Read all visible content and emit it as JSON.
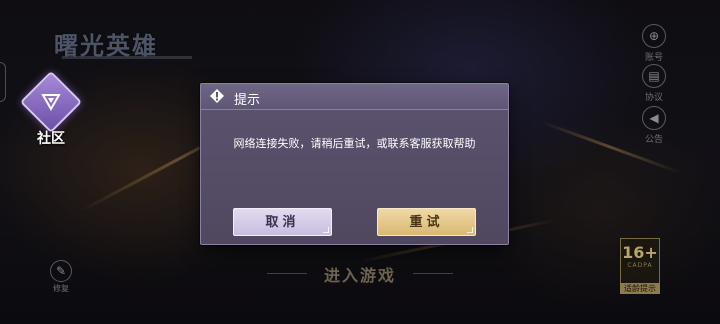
{
  "game": {
    "logo_text": "曙光英雄",
    "community_label": "社区",
    "enter_game_label": "进入游戏"
  },
  "side_buttons": [
    {
      "icon": "account-icon",
      "glyph": "⊕",
      "label": "账号"
    },
    {
      "icon": "document-icon",
      "glyph": "▤",
      "label": "协议"
    },
    {
      "icon": "megaphone-icon",
      "glyph": "◀",
      "label": "公告"
    }
  ],
  "repair": {
    "icon": "wrench-icon",
    "glyph": "✎",
    "label": "修复"
  },
  "age_rating": {
    "number": "16+",
    "org": "CADPA",
    "label": "适龄提示"
  },
  "dialog": {
    "title": "提示",
    "message": "网络连接失败，请稍后重试，或联系客服获取帮助",
    "cancel_label": "取消",
    "retry_label": "重试",
    "icon": "warning-icon"
  },
  "colors": {
    "dialog_bg": "#5c5370",
    "cancel_bg": "#d8cfe8",
    "retry_bg": "#e6c98a",
    "community_accent": "#8a6cc4"
  }
}
